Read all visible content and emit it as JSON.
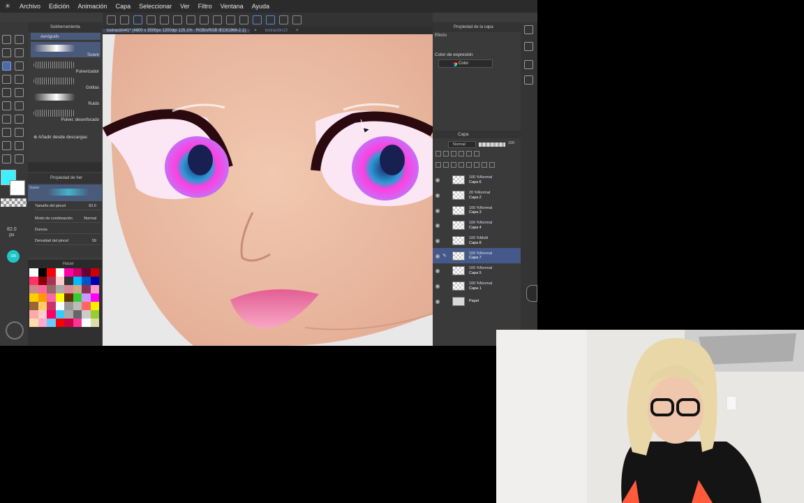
{
  "menu": {
    "items": [
      "Archivo",
      "Edición",
      "Animación",
      "Capa",
      "Seleccionar",
      "Ver",
      "Filtro",
      "Ventana",
      "Ayuda"
    ]
  },
  "doc_tabs": [
    {
      "label": "lustración41* (4800 x 3500px 1200dpi 125.1% : RGB/sRGB IEC61966-2.1)",
      "state": "active"
    },
    {
      "label": "lustración13",
      "state": "inactive"
    }
  ],
  "sub_tool": {
    "title": "Subherramienta",
    "brushes": [
      {
        "label": "Aerógrafo",
        "selected": true
      },
      {
        "label": "Suave",
        "selected": true
      },
      {
        "label": "Pulverizador",
        "selected": false
      },
      {
        "label": "Gotitas",
        "selected": false
      },
      {
        "label": "Ruido",
        "selected": false
      },
      {
        "label": "Pulver. desenfocado",
        "selected": false
      }
    ],
    "add_download": "Añadir desde descargas"
  },
  "tool_property": {
    "title": "Propiedad de her",
    "preset": "Suave",
    "rows": [
      {
        "label": "Tamaño del pincel",
        "value": "82.0"
      },
      {
        "label": "Modo de combinación",
        "value": "Normal"
      },
      {
        "label": "Dureza",
        "value": ""
      },
      {
        "label": "Densidad del pincel",
        "value": "59"
      }
    ]
  },
  "brush_size": {
    "value": "82.0",
    "unit": "px",
    "dot_label": "100"
  },
  "colors": {
    "main": "#3ef0ff",
    "sub": "#ffffff",
    "accent": "#4b6aa8"
  },
  "palette": {
    "title": "Hacer",
    "swatches": [
      "#ffffff",
      "#000000",
      "#ff0000",
      "#ffffff",
      "#ff00aa",
      "#cc0066",
      "#660033",
      "#cc0000",
      "#ff3366",
      "#880000",
      "#aa3355",
      "#ffcccc",
      "#333333",
      "#00bbff",
      "#0055cc",
      "#0000aa",
      "#cc8888",
      "#ff6699",
      "#996666",
      "#aaaaaa",
      "#dd8899",
      "#ccaa88",
      "#883355",
      "#ff99cc",
      "#ffcc00",
      "#ff9900",
      "#ff66aa",
      "#ffff00",
      "#663300",
      "#33cc33",
      "#cc99ff",
      "#ff00ff",
      "#996633",
      "#ffcc66",
      "#cc3366",
      "#ffffff",
      "#999999",
      "#bbbbbb",
      "#ff6666",
      "#ffee00",
      "#ffaaaa",
      "#ffcccc",
      "#ff0066",
      "#33ccff",
      "#aaaaaa",
      "#666666",
      "#cccccc",
      "#99cc33",
      "#ffddaa",
      "#ffaacc",
      "#66ccff",
      "#ff0000",
      "#cc0044",
      "#ff3399",
      "#ffffff",
      "#ddddaa"
    ]
  },
  "right_panel": {
    "tab": "Propiedad de la capa",
    "efecto": "Efecto",
    "color_label": "Color de expresión",
    "color_value": "Color"
  },
  "layers_panel": {
    "title": "Capa",
    "blend": "Normal",
    "opacity": "100",
    "layers": [
      {
        "mode": "100 %Normal",
        "name": "Capa 6",
        "selected": false,
        "paper": false
      },
      {
        "mode": "20 %Normal",
        "name": "Capa 2",
        "selected": false,
        "paper": false
      },
      {
        "mode": "100 %Normal",
        "name": "Capa 3",
        "selected": false,
        "paper": false
      },
      {
        "mode": "100 %Normal",
        "name": "Capa 4",
        "selected": false,
        "paper": false
      },
      {
        "mode": "100 %Multi",
        "name": "Capa 8",
        "selected": false,
        "paper": false
      },
      {
        "mode": "100 %Normal",
        "name": "Capa 7",
        "selected": true,
        "paper": false
      },
      {
        "mode": "100 %Normal",
        "name": "Capa 5",
        "selected": false,
        "paper": false
      },
      {
        "mode": "100 %Normal",
        "name": "Capa 1",
        "selected": false,
        "paper": false
      },
      {
        "mode": "",
        "name": "Papel",
        "selected": false,
        "paper": true
      }
    ]
  }
}
